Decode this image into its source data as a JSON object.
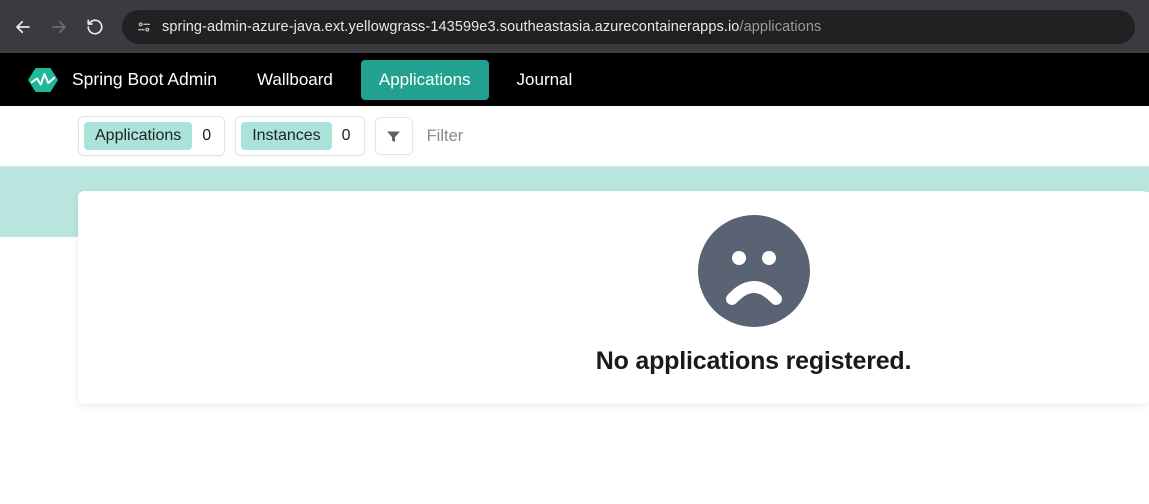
{
  "browser": {
    "url_host": "spring-admin-azure-java.ext.yellowgrass-143599e3.southeastasia.azurecontainerapps.io",
    "url_path": "/applications"
  },
  "header": {
    "brand": "Spring Boot Admin",
    "nav": {
      "wallboard": "Wallboard",
      "applications": "Applications",
      "journal": "Journal"
    }
  },
  "filters": {
    "applications_label": "Applications",
    "applications_count": "0",
    "instances_label": "Instances",
    "instances_count": "0",
    "filter_placeholder": "Filter"
  },
  "main": {
    "empty_message": "No applications registered."
  },
  "colors": {
    "accent": "#22a190",
    "teal_light": "#b8e6de",
    "sad_face": "#5a6373"
  }
}
